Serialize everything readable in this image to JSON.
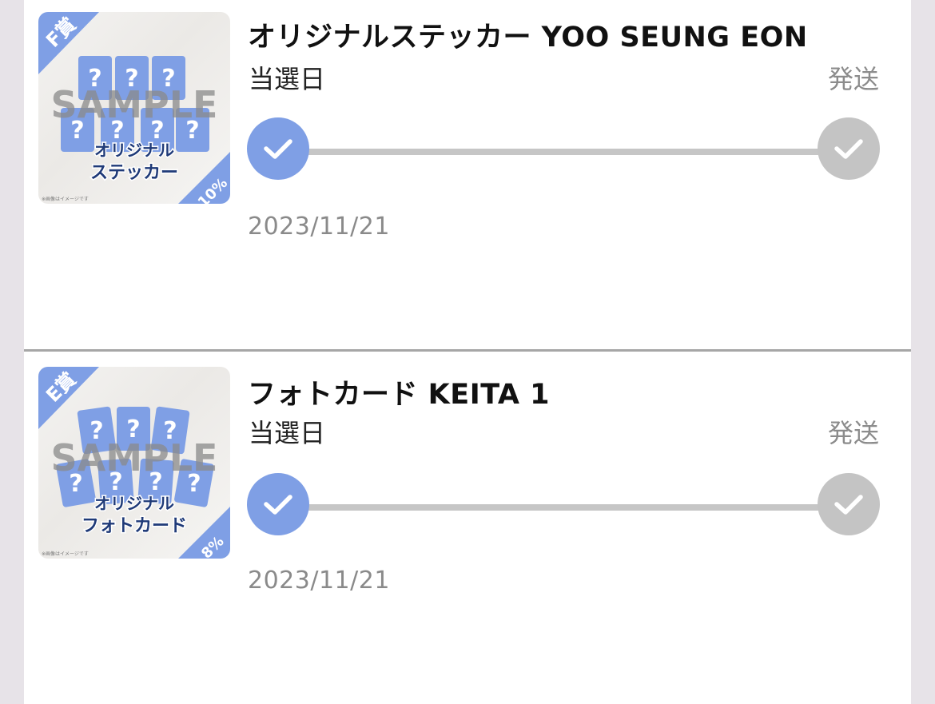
{
  "items": [
    {
      "title": "オリジナルステッカー YOO SEUNG EON",
      "status_left": "当選日",
      "status_right": "発送",
      "date": "2023/11/21",
      "thumbnail": {
        "prize_badge": "F賞",
        "watermark": "SAMPLE",
        "line1": "オリジナル",
        "line2": "ステッカー",
        "percent": "10%",
        "note": "※画像はイメージです"
      },
      "progress": {
        "step1_done": true,
        "step2_done": false
      }
    },
    {
      "title": "フォトカード KEITA 1",
      "status_left": "当選日",
      "status_right": "発送",
      "date": "2023/11/21",
      "thumbnail": {
        "prize_badge": "E賞",
        "watermark": "SAMPLE",
        "line1": "オリジナル",
        "line2": "フォトカード",
        "percent": "8%",
        "note": "※画像はイメージです"
      },
      "progress": {
        "step1_done": true,
        "step2_done": false
      }
    }
  ],
  "colors": {
    "accent": "#7f9fe5",
    "pending": "#c4c4c4",
    "navy": "#1f3a78"
  }
}
